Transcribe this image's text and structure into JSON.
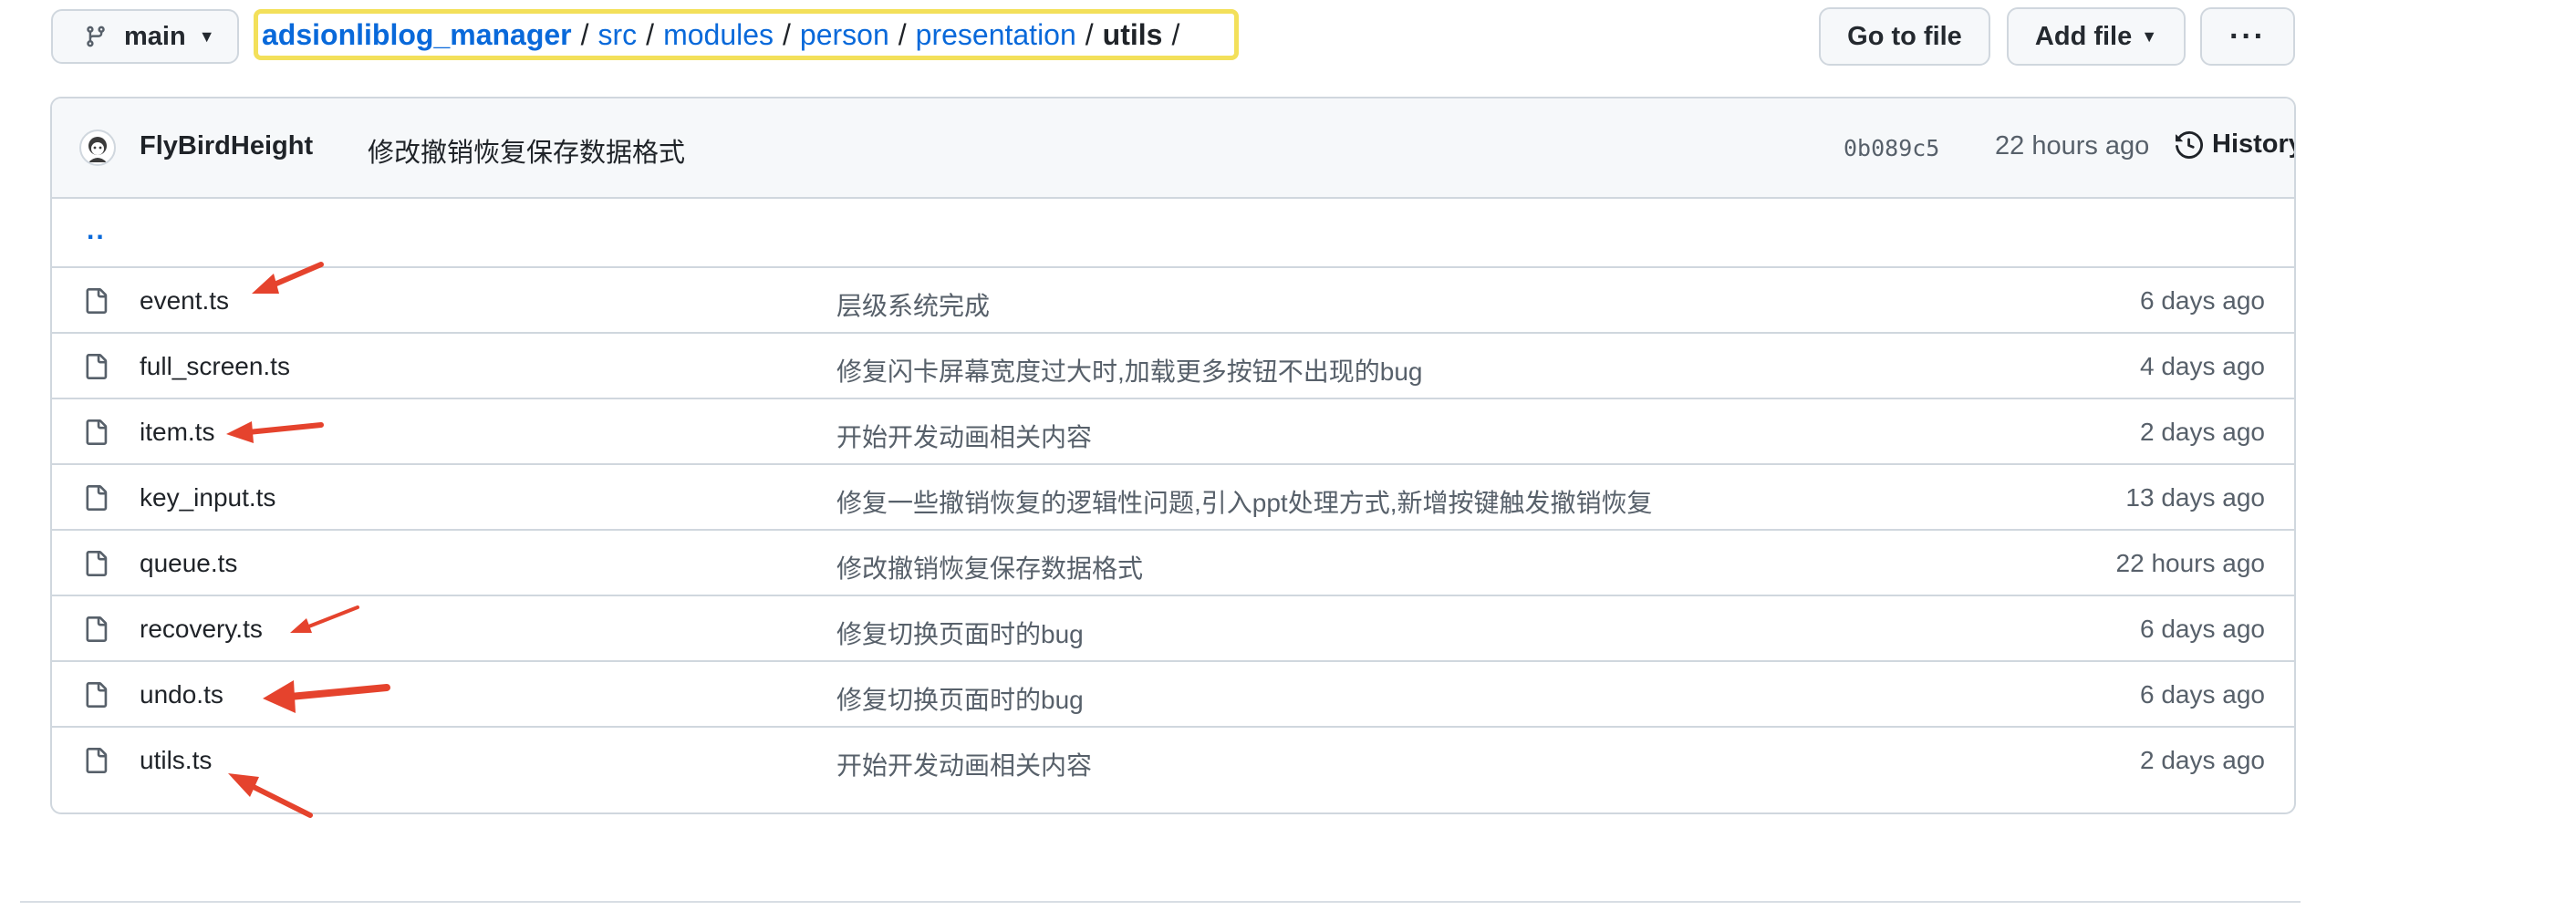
{
  "branch": {
    "name": "main"
  },
  "breadcrumb": {
    "repo": "adsionliblog_manager",
    "segments": [
      "src",
      "modules",
      "person",
      "presentation"
    ],
    "current": "utils",
    "separator": "/"
  },
  "actions": {
    "go_to_file": "Go to file",
    "add_file": "Add file",
    "more": "···"
  },
  "latest_commit": {
    "author": "FlyBirdHeight",
    "message": "修改撤销恢复保存数据格式",
    "sha": "0b089c5",
    "time": "22 hours ago",
    "history_label": "History"
  },
  "parent_link": "..",
  "files": [
    {
      "name": "event.ts",
      "commit": "层级系统完成",
      "age": "6 days ago"
    },
    {
      "name": "full_screen.ts",
      "commit": "修复闪卡屏幕宽度过大时,加载更多按钮不出现的bug",
      "age": "4 days ago"
    },
    {
      "name": "item.ts",
      "commit": "开始开发动画相关内容",
      "age": "2 days ago"
    },
    {
      "name": "key_input.ts",
      "commit": "修复一些撤销恢复的逻辑性问题,引入ppt处理方式,新增按键触发撤销恢复",
      "age": "13 days ago"
    },
    {
      "name": "queue.ts",
      "commit": "修改撤销恢复保存数据格式",
      "age": "22 hours ago"
    },
    {
      "name": "recovery.ts",
      "commit": "修复切换页面时的bug",
      "age": "6 days ago"
    },
    {
      "name": "undo.ts",
      "commit": "修复切换页面时的bug",
      "age": "6 days ago"
    },
    {
      "name": "utils.ts",
      "commit": "开始开发动画相关内容",
      "age": "2 days ago"
    }
  ],
  "colors": {
    "link": "#0969da",
    "highlight_border": "#f3e05a",
    "annotation_arrow": "#e5432d",
    "muted_text": "#57606a"
  }
}
